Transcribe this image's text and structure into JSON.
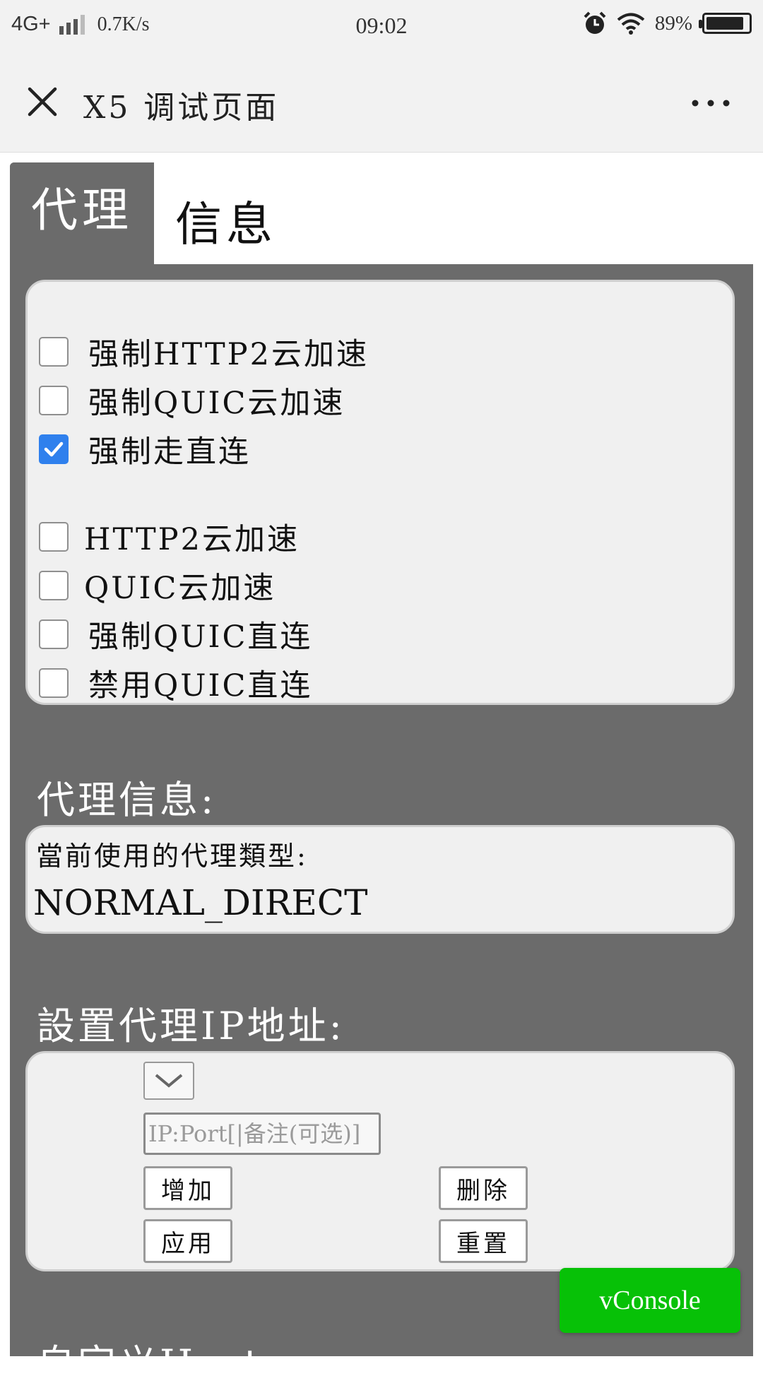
{
  "status_bar": {
    "network": "4G+",
    "speed": "0.7K/s",
    "time": "09:02",
    "battery": "89%",
    "battery_level": 89
  },
  "title_bar": {
    "title": "X5 调试页面"
  },
  "tabs": [
    {
      "label": "代理"
    },
    {
      "label": "信息"
    }
  ],
  "options_group1": [
    {
      "label": "强制HTTP2云加速",
      "checked": false
    },
    {
      "label": "强制QUIC云加速",
      "checked": false
    },
    {
      "label": "强制走直连",
      "checked": true
    }
  ],
  "options_group2": [
    {
      "label": "HTTP2云加速",
      "checked": false
    },
    {
      "label": "QUIC云加速",
      "checked": false
    },
    {
      "label": "强制QUIC直连",
      "checked": false
    },
    {
      "label": "禁用QUIC直连",
      "checked": false
    }
  ],
  "proxy_info": {
    "section_title": "代理信息:",
    "label": "當前使用的代理類型:",
    "value": "NORMAL_DIRECT"
  },
  "proxy_ip": {
    "section_title": "設置代理IP地址:",
    "input_value": "",
    "input_placeholder": "IP:Port[|备注(可选)]",
    "add_label": "增加",
    "delete_label": "删除",
    "apply_label": "应用",
    "reset_label": "重置"
  },
  "next_section_title": "自定义Hosts:",
  "vconsole_label": "vConsole",
  "colors": {
    "panel_bg": "#6b6b6b",
    "card_bg": "#f0f0f0",
    "checkbox_checked": "#2f80ed",
    "vconsole_green": "#07c107"
  }
}
